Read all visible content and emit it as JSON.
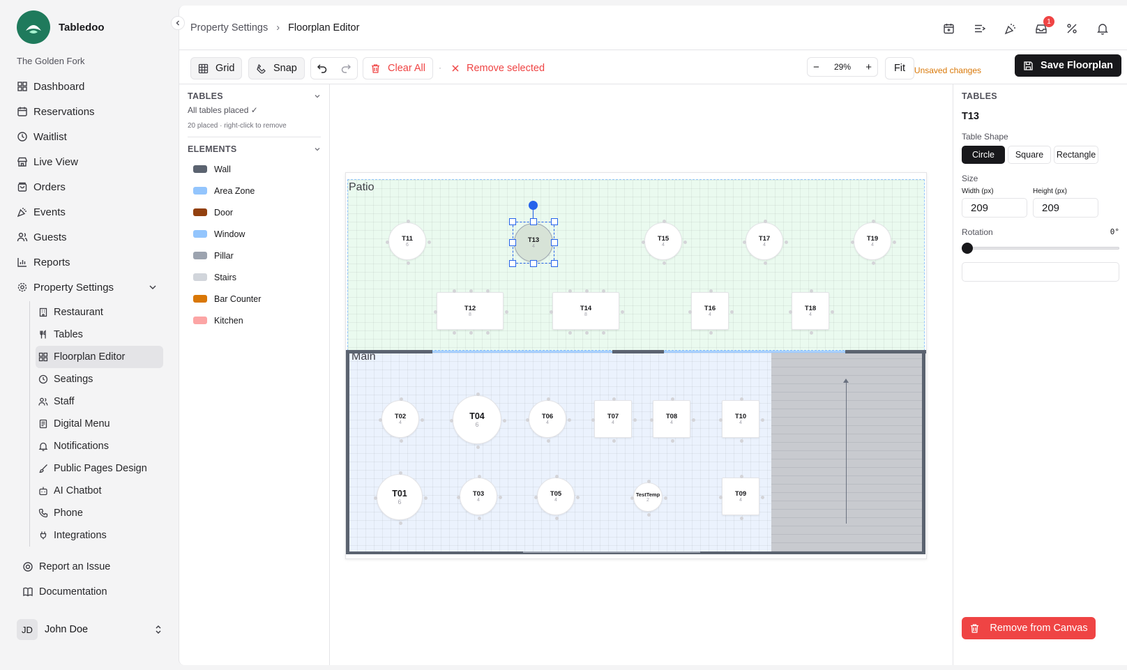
{
  "app": {
    "name": "Tabledoo",
    "restaurant": "The Golden Fork"
  },
  "sidebar": {
    "items": [
      {
        "label": "Dashboard",
        "icon": "grid-icon"
      },
      {
        "label": "Reservations",
        "icon": "calendar-icon"
      },
      {
        "label": "Waitlist",
        "icon": "clock-icon"
      },
      {
        "label": "Live View",
        "icon": "store-icon"
      },
      {
        "label": "Orders",
        "icon": "bag-icon"
      },
      {
        "label": "Events",
        "icon": "party-icon"
      },
      {
        "label": "Guests",
        "icon": "users-icon"
      },
      {
        "label": "Reports",
        "icon": "chart-icon"
      },
      {
        "label": "Property Settings",
        "icon": "gear-icon"
      }
    ],
    "sub_items": [
      {
        "label": "Restaurant"
      },
      {
        "label": "Tables"
      },
      {
        "label": "Floorplan Editor",
        "active": true
      },
      {
        "label": "Seatings"
      },
      {
        "label": "Staff"
      },
      {
        "label": "Digital Menu"
      },
      {
        "label": "Notifications"
      },
      {
        "label": "Public Pages Design"
      },
      {
        "label": "AI Chatbot"
      },
      {
        "label": "Phone"
      },
      {
        "label": "Integrations"
      }
    ],
    "bottom": [
      {
        "label": "Report an Issue"
      },
      {
        "label": "Documentation"
      }
    ],
    "user": {
      "initials": "JD",
      "name": "John Doe"
    }
  },
  "breadcrumb": {
    "parent": "Property Settings",
    "current": "Floorplan Editor"
  },
  "header": {
    "notification_count": "1"
  },
  "toolbar": {
    "grid": "Grid",
    "snap": "Snap",
    "clear_all": "Clear All",
    "remove_selected": "Remove selected",
    "zoom": "29%",
    "fit": "Fit",
    "unsaved": "Unsaved changes",
    "save": "Save Floorplan"
  },
  "left_panel": {
    "tables_title": "TABLES",
    "tables_status": "All tables placed ✓",
    "tables_hint": "20 placed · right-click to remove",
    "elements_title": "ELEMENTS",
    "elements": [
      {
        "label": "Wall",
        "color": "#5b6370"
      },
      {
        "label": "Area Zone",
        "color": "#93c5fd"
      },
      {
        "label": "Door",
        "color": "#92400e"
      },
      {
        "label": "Window",
        "color": "#93c5fd"
      },
      {
        "label": "Pillar",
        "color": "#9ca3af"
      },
      {
        "label": "Stairs",
        "color": "#d1d5db"
      },
      {
        "label": "Bar Counter",
        "color": "#d97706"
      },
      {
        "label": "Kitchen",
        "color": "#fca5a5"
      }
    ]
  },
  "floorplan": {
    "zones": [
      {
        "label": "Patio"
      },
      {
        "label": "Main"
      }
    ],
    "tables": [
      {
        "name": "T11",
        "seats": "6"
      },
      {
        "name": "T13",
        "seats": "4"
      },
      {
        "name": "T15",
        "seats": "4"
      },
      {
        "name": "T17",
        "seats": "4"
      },
      {
        "name": "T19",
        "seats": "4"
      },
      {
        "name": "T12",
        "seats": "8"
      },
      {
        "name": "T14",
        "seats": "8"
      },
      {
        "name": "T16",
        "seats": "4"
      },
      {
        "name": "T18",
        "seats": "4"
      },
      {
        "name": "T02",
        "seats": "4"
      },
      {
        "name": "T04",
        "seats": "6"
      },
      {
        "name": "T06",
        "seats": "4"
      },
      {
        "name": "T07",
        "seats": "4"
      },
      {
        "name": "T08",
        "seats": "4"
      },
      {
        "name": "T10",
        "seats": "4"
      },
      {
        "name": "T01",
        "seats": "6"
      },
      {
        "name": "T03",
        "seats": "4"
      },
      {
        "name": "T05",
        "seats": "4"
      },
      {
        "name": "TestTemp",
        "seats": "2"
      },
      {
        "name": "T09",
        "seats": "4"
      }
    ]
  },
  "right_panel": {
    "title": "TABLES",
    "selected": "T13",
    "shape_label": "Table Shape",
    "shapes": [
      "Circle",
      "Square",
      "Rectangle"
    ],
    "size_label": "Size",
    "width_label": "Width (px)",
    "width": "209",
    "height_label": "Height (px)",
    "height": "209",
    "rotation_label": "Rotation",
    "rotation": "0°",
    "remove": "Remove from Canvas"
  }
}
